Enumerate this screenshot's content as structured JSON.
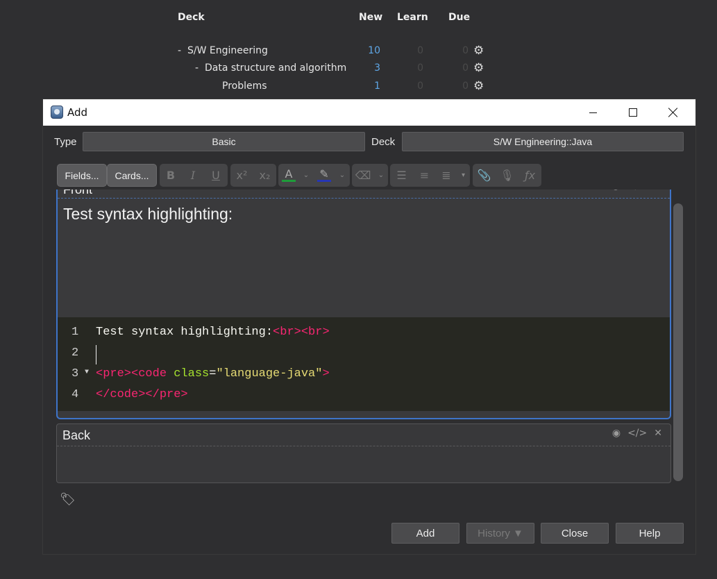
{
  "deck_browser": {
    "headers": {
      "deck": "Deck",
      "new": "New",
      "learn": "Learn",
      "due": "Due"
    },
    "rows": [
      {
        "collapse": "-",
        "name": "S/W Engineering",
        "new": "10",
        "learn": "0",
        "due": "0"
      },
      {
        "collapse": "-",
        "name": "Data structure and algorithm",
        "new": "3",
        "learn": "0",
        "due": "0"
      },
      {
        "collapse": "",
        "name": "Problems",
        "new": "1",
        "learn": "0",
        "due": "0"
      }
    ]
  },
  "dialog": {
    "title": "Add",
    "type_label": "Type",
    "type_value": "Basic",
    "deck_label": "Deck",
    "deck_value": "S/W Engineering::Java",
    "toolbar": {
      "fields_label": "Fields...",
      "cards_label": "Cards..."
    },
    "front": {
      "label": "Front",
      "rich_text": "Test syntax highlighting:",
      "code_lines": [
        {
          "num": "1",
          "text": "Test syntax highlighting:",
          "tags": "<br><br>"
        },
        {
          "num": "2",
          "text": ""
        },
        {
          "num": "3",
          "tag_open": "<pre><code ",
          "attr": "class",
          "eq": "=",
          "str": "\"language-java\"",
          "tag_close": ">"
        },
        {
          "num": "4",
          "tags": "</code></pre>"
        }
      ]
    },
    "back": {
      "label": "Back"
    },
    "buttons": {
      "add": "Add",
      "history": "History ▼",
      "close": "Close",
      "help": "Help"
    }
  }
}
